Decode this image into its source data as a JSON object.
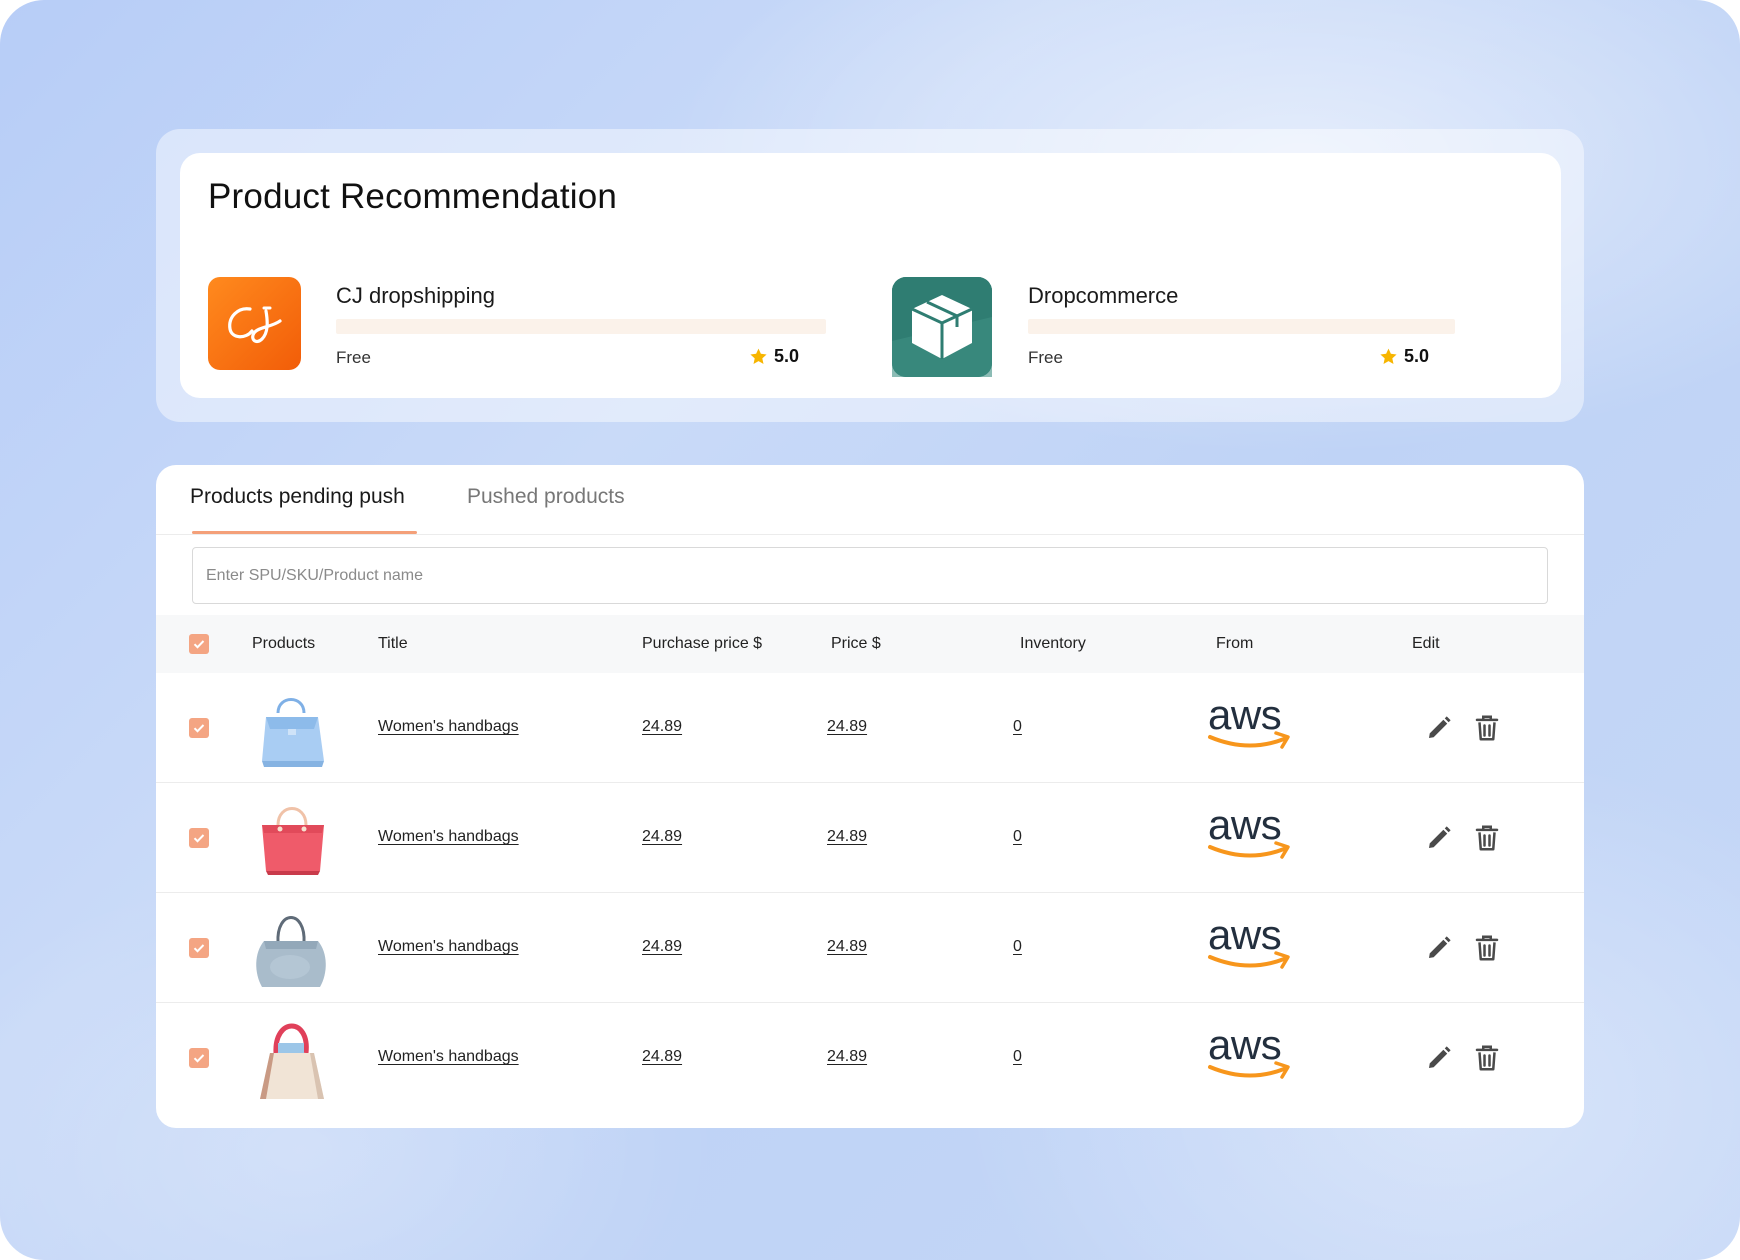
{
  "recommendation": {
    "title": "Product Recommendation",
    "apps": [
      {
        "name": "CJ dropshipping",
        "price": "Free",
        "rating": "5.0",
        "logo_text": "CJ",
        "logo_color": "#f56a0f"
      },
      {
        "name": "Dropcommerce",
        "price": "Free",
        "rating": "5.0",
        "logo_icon": "package-icon",
        "logo_color": "#2f7d72"
      }
    ]
  },
  "tabs": {
    "active": "Products pending push",
    "inactive": "Pushed products"
  },
  "search": {
    "placeholder": "Enter SPU/SKU/Product name",
    "value": ""
  },
  "table": {
    "headers": {
      "products": "Products",
      "title": "Title",
      "purchase_price": "Purchase price $",
      "price": "Price $",
      "inventory": "Inventory",
      "from": "From",
      "edit": "Edit"
    },
    "rows": [
      {
        "title": "Women's handbags",
        "purchase_price": "24.89",
        "price": "24.89",
        "inventory": "0",
        "from": "aws",
        "thumb": "blue-handbag",
        "checked": true
      },
      {
        "title": "Women's handbags",
        "purchase_price": "24.89",
        "price": "24.89",
        "inventory": "0",
        "from": "aws",
        "thumb": "red-handbag",
        "checked": true
      },
      {
        "title": "Women's handbags",
        "purchase_price": "24.89",
        "price": "24.89",
        "inventory": "0",
        "from": "aws",
        "thumb": "grey-handbag",
        "checked": true
      },
      {
        "title": "Women's handbags",
        "purchase_price": "24.89",
        "price": "24.89",
        "inventory": "0",
        "from": "aws",
        "thumb": "beige-handbag",
        "checked": true
      }
    ]
  },
  "colors": {
    "accent": "#f4a583",
    "tab_underline": "#f4a079",
    "star": "#f7b500",
    "aws_smile": "#f7961c"
  }
}
